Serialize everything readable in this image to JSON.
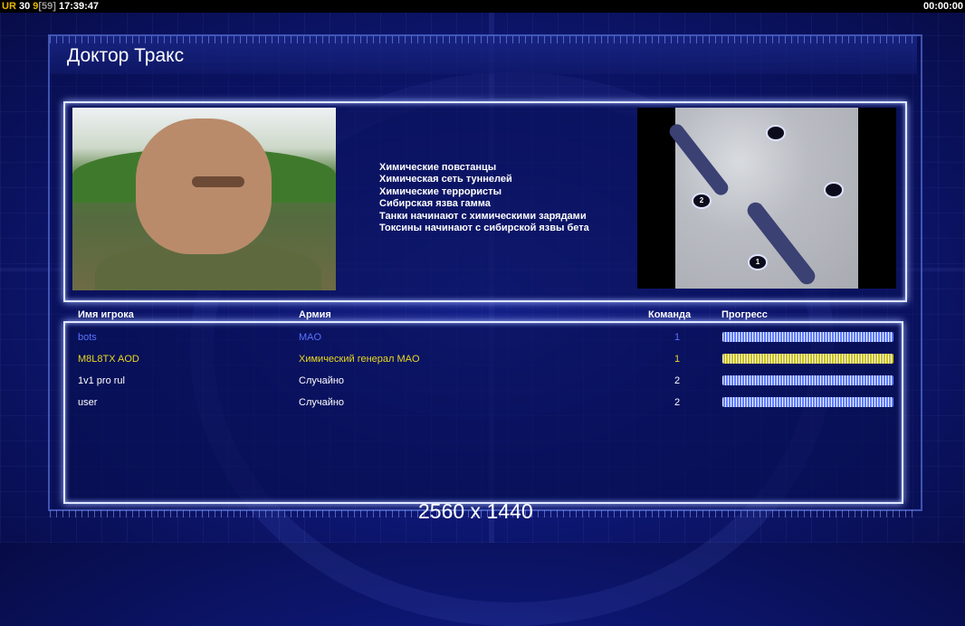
{
  "status_bar": {
    "ur": "UR",
    "num1": "30",
    "num2": "9",
    "bracket_value": "[59]",
    "time": "17:39:47",
    "timer": "00:00:00"
  },
  "title": "Доктор Тракс",
  "bullets": [
    "Химические повстанцы",
    "Химическая сеть туннелей",
    "Химические террористы",
    "Сибирская язва гамма",
    "Танки начинают с химическими зарядами",
    "Токсины начинают с сибирской язвы бета"
  ],
  "minimap": {
    "slots": [
      {
        "label": ""
      },
      {
        "label": "2"
      },
      {
        "label": ""
      },
      {
        "label": "1"
      }
    ]
  },
  "table": {
    "headers": {
      "name": "Имя игрока",
      "army": "Армия",
      "team": "Команда",
      "progress": "Прогресс"
    },
    "rows": [
      {
        "name": "bots",
        "army": "MAO",
        "team": "1",
        "color": "#5a73ff",
        "progress": 1.0
      },
      {
        "name": "M8L8TX AOD",
        "army": "Химический генерал MAO",
        "team": "1",
        "color": "#e9d722",
        "progress": 1.0
      },
      {
        "name": "1v1 pro rul",
        "army": "Случайно",
        "team": "2",
        "color": "#ffffff",
        "progress": 1.0
      },
      {
        "name": "user",
        "army": "Случайно",
        "team": "2",
        "color": "#ffffff",
        "progress": 1.0
      }
    ]
  },
  "resolution": "2560 x 1440"
}
